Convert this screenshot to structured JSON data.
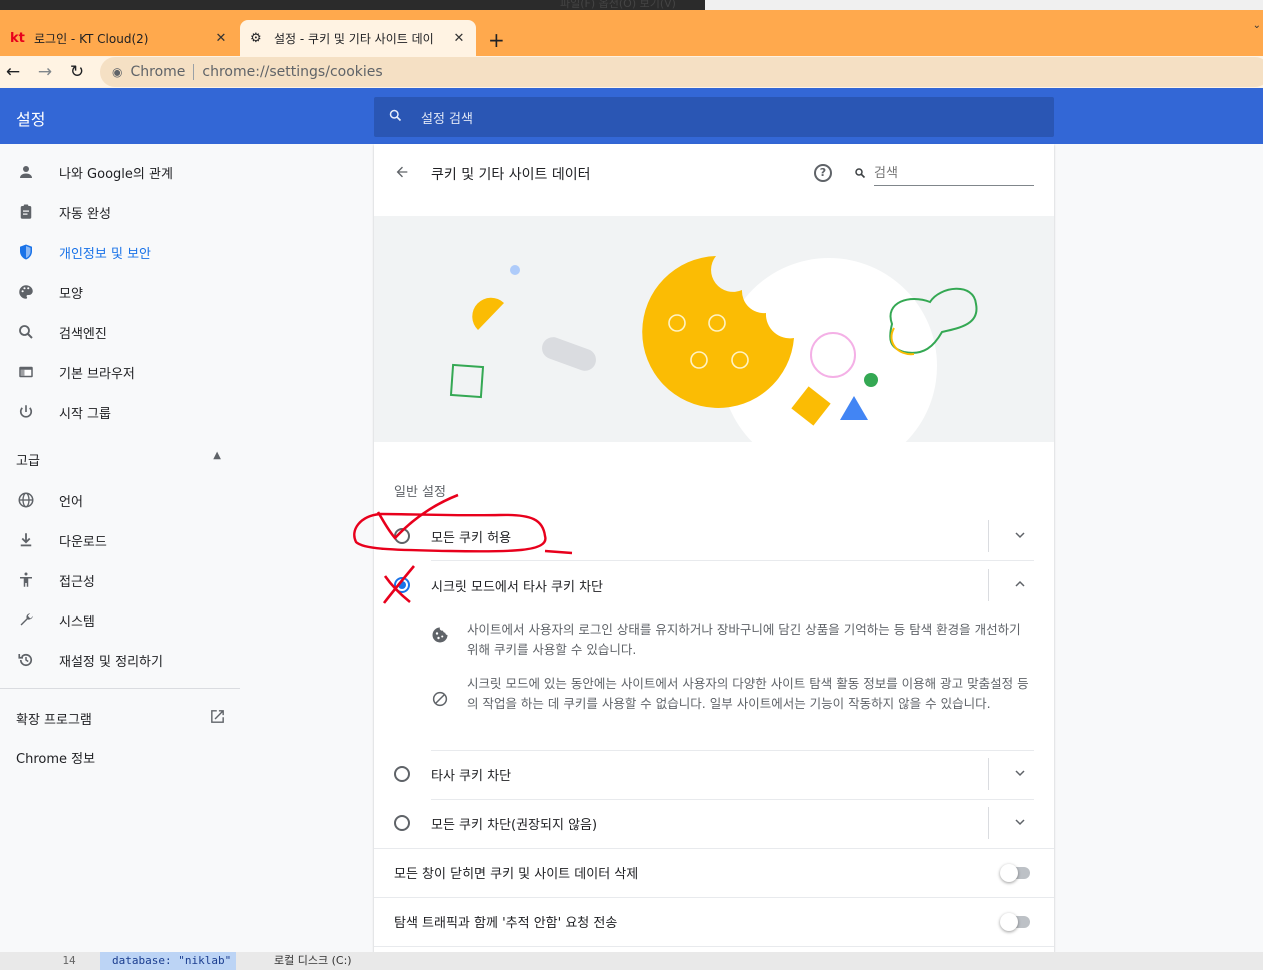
{
  "desktop": {
    "menu": "파일(F)   옵션(O)   보기(V)"
  },
  "tabs": [
    {
      "favicon": "kt",
      "title": "로그인 - KT Cloud(2)",
      "close": "✕"
    },
    {
      "favicon": "gear-icon",
      "title": "설정 - 쿠키 및 기타 사이트 데이",
      "close": "✕"
    }
  ],
  "newtab": "+",
  "omnibox": {
    "chrome_label": "Chrome",
    "url": "chrome://settings/cookies"
  },
  "header": {
    "brand": "설정",
    "search_placeholder": "설정 검색"
  },
  "sidebar": {
    "items": [
      {
        "label": "나와 Google의 관계",
        "icon": "person-icon"
      },
      {
        "label": "자동 완성",
        "icon": "clipboard-icon"
      },
      {
        "label": "개인정보 및 보안",
        "icon": "shield-icon"
      },
      {
        "label": "모양",
        "icon": "palette-icon"
      },
      {
        "label": "검색엔진",
        "icon": "search-icon"
      },
      {
        "label": "기본 브라우저",
        "icon": "browser-icon"
      },
      {
        "label": "시작 그룹",
        "icon": "power-icon"
      }
    ],
    "advanced": "고급",
    "advanced_items": [
      {
        "label": "언어",
        "icon": "globe-icon"
      },
      {
        "label": "다운로드",
        "icon": "download-icon"
      },
      {
        "label": "접근성",
        "icon": "accessibility-icon"
      },
      {
        "label": "시스템",
        "icon": "wrench-icon"
      },
      {
        "label": "재설정 및 정리하기",
        "icon": "history-icon"
      }
    ],
    "extensions": "확장 프로그램",
    "about": "Chrome 정보"
  },
  "page": {
    "title": "쿠키 및 기타 사이트 데이터",
    "search_placeholder": "검색",
    "section_label": "일반 설정",
    "options": [
      {
        "label": "모든 쿠키 허용",
        "checked": false,
        "expanded": false
      },
      {
        "label": "시크릿 모드에서 타사 쿠키 차단",
        "checked": true,
        "expanded": true
      },
      {
        "label": "타사 쿠키 차단",
        "checked": false,
        "expanded": false
      },
      {
        "label": "모든 쿠키 차단(권장되지 않음)",
        "checked": false,
        "expanded": false
      }
    ],
    "descriptions": [
      {
        "icon": "cookie-icon",
        "text": "사이트에서 사용자의 로그인 상태를 유지하거나 장바구니에 담긴 상품을 기억하는 등 탐색 환경을 개선하기 위해 쿠키를 사용할 수 있습니다."
      },
      {
        "icon": "block-icon",
        "text": "시크릿 모드에 있는 동안에는 사이트에서 사용자의 다양한 사이트 탐색 활동 정보를 이용해 광고 맞춤설정 등의 작업을 하는 데 쿠키를 사용할 수 없습니다. 일부 사이트에서는 기능이 작동하지 않을 수 있습니다."
      }
    ],
    "toggles": [
      {
        "label": "모든 창이 닫히면 쿠키 및 사이트 데이터 삭제",
        "on": false
      },
      {
        "label": "탐색 트래픽과 함께 '추적 안함' 요청 전송",
        "on": false
      }
    ]
  },
  "bottom": {
    "line_number": "14",
    "code": "database: \"niklab\"",
    "disk": "로컬 디스크 (C:)"
  },
  "colors": {
    "tab_bar": "#ffa94d",
    "header": "#3367d6",
    "accent": "#1a73e8",
    "annotation": "#e8001c"
  }
}
